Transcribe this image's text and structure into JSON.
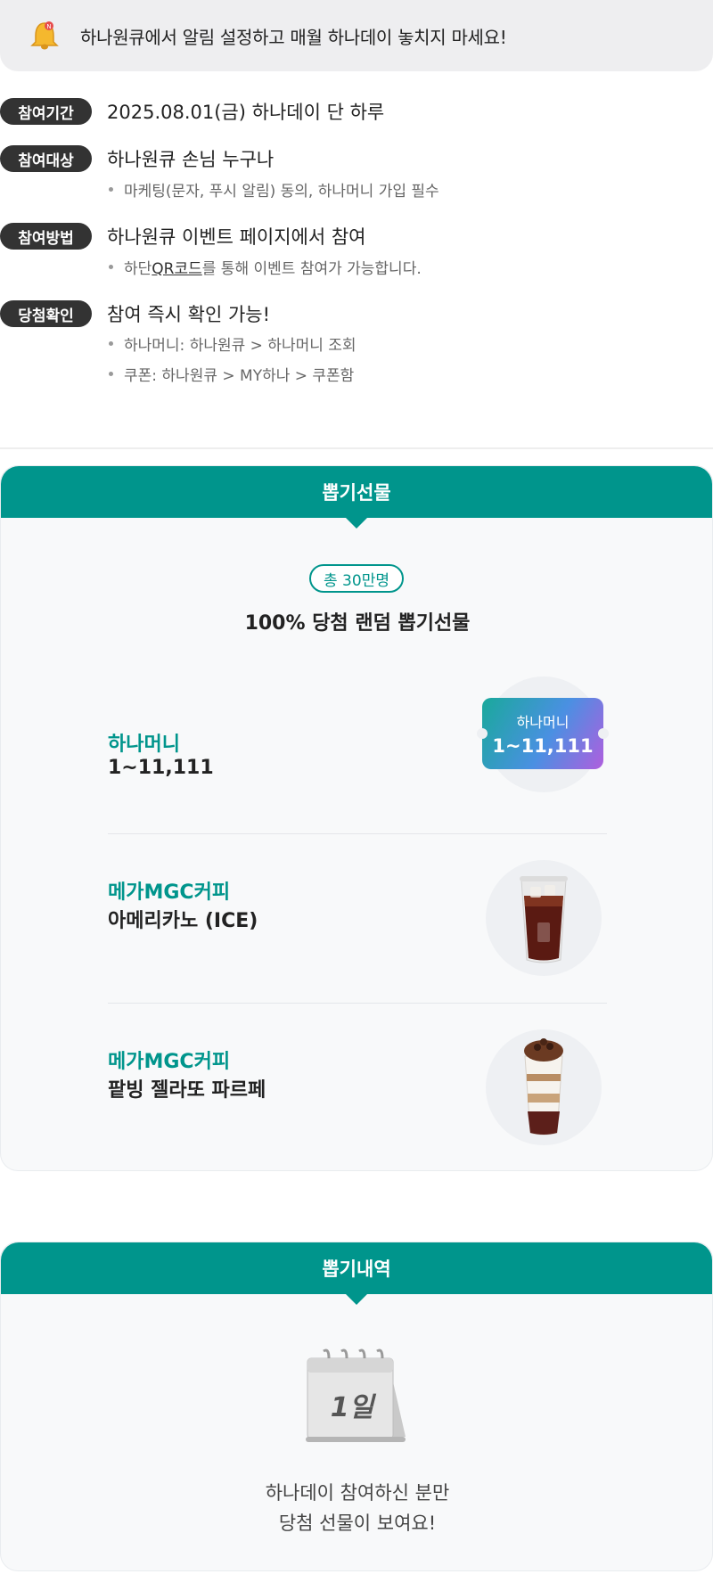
{
  "notice": {
    "icon": "bell-icon",
    "text": "하나원큐에서 알림 설정하고 매월 하나데이 놓치지 마세요!"
  },
  "info": {
    "period": {
      "tag": "참여기간",
      "text": "2025.08.01(금) 하나데이 단 하루"
    },
    "target": {
      "tag": "참여대상",
      "text": "하나원큐 손님 누구나",
      "note": "마케팅(문자, 푸시 알림) 동의, 하나머니 가입 필수"
    },
    "method": {
      "tag": "참여방법",
      "text": "하나원큐 이벤트 페이지에서 참여",
      "note_prefix": "하단 ",
      "note_link": "QR코드",
      "note_suffix": "를 통해 이벤트 참여가 가능합니다."
    },
    "result": {
      "tag": "당첨확인",
      "text": "참여 즉시 확인 가능!",
      "notes": [
        "하나머니: 하나원큐 > 하나머니 조회",
        "쿠폰: 하나원큐 > MY하나 > 쿠폰함"
      ]
    }
  },
  "gifts": {
    "header": "뽑기선물",
    "pill": "총 30만명",
    "headline": "100% 당첨 랜덤 뽑기선물",
    "items": [
      {
        "brand": "하나머니",
        "name": "1~11,111",
        "badge_label": "하나머니",
        "badge_value": "1~11,111"
      },
      {
        "brand": "메가MGC커피",
        "name": "아메리카노 (ICE)",
        "image": "iced-americano-image"
      },
      {
        "brand": "메가MGC커피",
        "name": "팥빙 젤라또 파르페",
        "image": "parfait-image"
      }
    ]
  },
  "history": {
    "header": "뽑기내역",
    "calendar_text": "1일",
    "line1": "하나데이 참여하신 분만",
    "line2": "당첨 선물이 보여요!"
  },
  "colors": {
    "accent": "#00958c",
    "tag_bg": "#333333"
  }
}
